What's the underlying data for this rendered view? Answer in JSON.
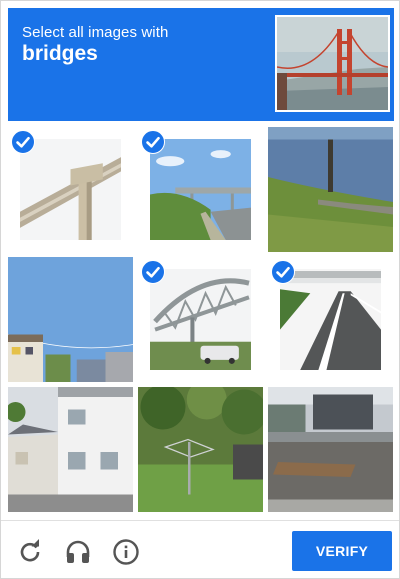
{
  "header": {
    "instruction": "Select all images with",
    "target": "bridges",
    "colors": {
      "accent": "#1a73e8"
    }
  },
  "grid": {
    "tiles": [
      {
        "row": 1,
        "col": 1,
        "selected": true,
        "content": "bridge-underside"
      },
      {
        "row": 1,
        "col": 2,
        "selected": true,
        "content": "overpass-road"
      },
      {
        "row": 1,
        "col": 3,
        "selected": false,
        "content": "riverbank-tree"
      },
      {
        "row": 2,
        "col": 1,
        "selected": false,
        "content": "sky-houses"
      },
      {
        "row": 2,
        "col": 2,
        "selected": true,
        "content": "truss-bridge"
      },
      {
        "row": 2,
        "col": 3,
        "selected": true,
        "content": "highway-overpass"
      },
      {
        "row": 3,
        "col": 1,
        "selected": false,
        "content": "white-house"
      },
      {
        "row": 3,
        "col": 2,
        "selected": false,
        "content": "garden-clothesline"
      },
      {
        "row": 3,
        "col": 3,
        "selected": false,
        "content": "industrial-lot"
      }
    ]
  },
  "footer": {
    "icons": [
      "reload-icon",
      "headphones-icon",
      "info-icon"
    ],
    "verify_label": "VERIFY"
  }
}
